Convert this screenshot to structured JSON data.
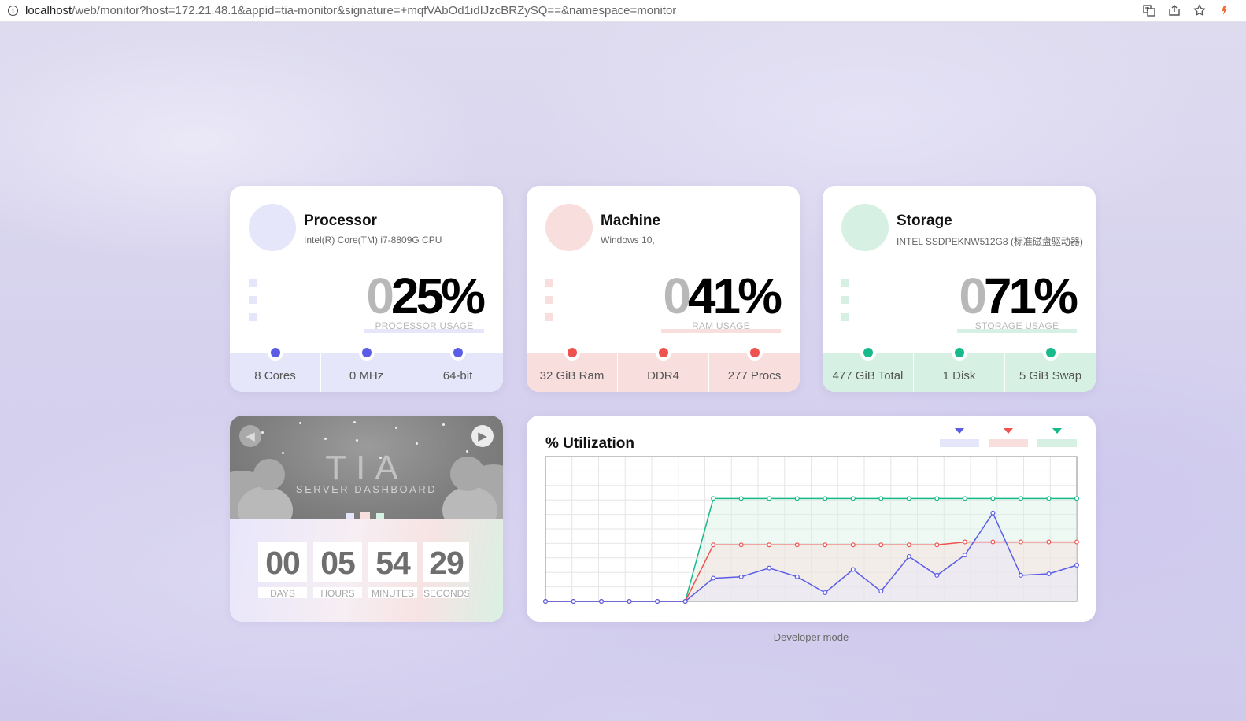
{
  "browser": {
    "url_host": "localhost",
    "url_rest": "/web/monitor?host=172.21.48.1&appid=tia-monitor&signature=+mqfVAbOd1idIJzcBRZySQ==&namespace=monitor"
  },
  "colors": {
    "processor": "#5b5de6",
    "machine": "#ef5350",
    "storage": "#18b98a",
    "processor_light": "#e6e6fb",
    "machine_light": "#f9dede",
    "storage_light": "#d6f1e3"
  },
  "processor": {
    "title": "Processor",
    "subtitle": "Intel(R) Core(TM) i7-8809G CPU",
    "big_lead": "0",
    "big_value": "25%",
    "usage_label": "PROCESSOR USAGE",
    "usage_percent": 25,
    "stats": [
      "8 Cores",
      "0 MHz",
      "64-bit"
    ]
  },
  "machine": {
    "title": "Machine",
    "subtitle": "Windows 10,",
    "big_lead": "0",
    "big_value": "41%",
    "usage_label": "RAM USAGE",
    "usage_percent": 41,
    "stats": [
      "32 GiB Ram",
      "DDR4",
      "277 Procs"
    ]
  },
  "storage": {
    "title": "Storage",
    "subtitle": "INTEL SSDPEKNW512G8 (标准磁盘驱动器)",
    "big_lead": "0",
    "big_value": "71%",
    "usage_label": "STORAGE USAGE",
    "usage_percent": 71,
    "stats": [
      "477 GiB Total",
      "1 Disk",
      "5 GiB Swap"
    ]
  },
  "uptime": {
    "title": "TIA",
    "subtitle": "SERVER DASHBOARD",
    "prev_icon": "chevron-left-icon",
    "next_icon": "play-icon",
    "counters": [
      {
        "value": "00",
        "unit": "DAYS"
      },
      {
        "value": "05",
        "unit": "HOURS"
      },
      {
        "value": "54",
        "unit": "MINUTES"
      },
      {
        "value": "29",
        "unit": "SECONDS"
      }
    ]
  },
  "chart_data": {
    "type": "line",
    "title": "% Utilization",
    "x": [
      0,
      1,
      2,
      3,
      4,
      5,
      6,
      7,
      8,
      9,
      10,
      11,
      12,
      13,
      14,
      15,
      16,
      17,
      18,
      19
    ],
    "ylim": [
      0,
      100
    ],
    "grid": true,
    "legend_position": "top-right",
    "series": [
      {
        "key": "storage",
        "color": "#18b98a",
        "fill": "#d6f1e3",
        "values": [
          0,
          0,
          0,
          0,
          0,
          0,
          71,
          71,
          71,
          71,
          71,
          71,
          71,
          71,
          71,
          71,
          71,
          71,
          71,
          71
        ]
      },
      {
        "key": "machine",
        "color": "#ef5350",
        "fill": "#f9dede",
        "values": [
          0,
          0,
          0,
          0,
          0,
          0,
          39,
          39,
          39,
          39,
          39,
          39,
          39,
          39,
          39,
          41,
          41,
          41,
          41,
          41
        ]
      },
      {
        "key": "processor",
        "color": "#5b5de6",
        "fill": "#e6e6fb",
        "values": [
          0,
          0,
          0,
          0,
          0,
          0,
          16,
          17,
          23,
          17,
          6,
          22,
          7,
          31,
          18,
          32,
          61,
          18,
          19,
          25
        ]
      }
    ]
  },
  "footer": {
    "note": "Developer mode"
  }
}
